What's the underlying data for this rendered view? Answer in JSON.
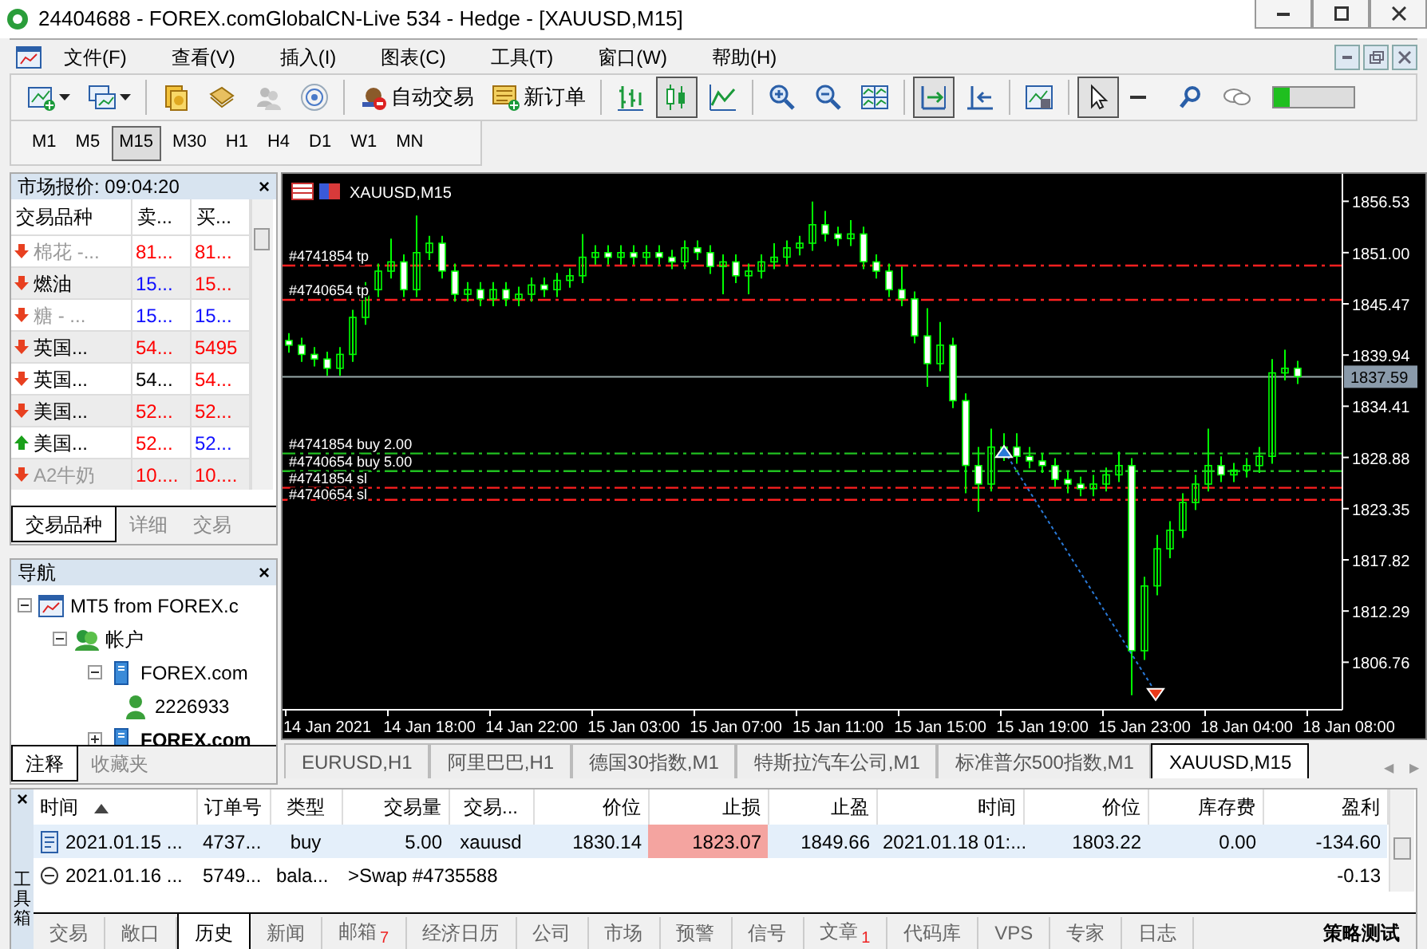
{
  "window": {
    "title": "24404688 - FOREX.comGlobalCN-Live 534 - Hedge - [XAUUSD,M15]"
  },
  "menu": [
    "文件(F)",
    "查看(V)",
    "插入(I)",
    "图表(C)",
    "工具(T)",
    "窗口(W)",
    "帮助(H)"
  ],
  "toolbar": [
    {
      "pressed": false,
      "dropdown": true
    },
    {
      "pressed": false,
      "dropdown": true
    },
    {
      "pressed": false
    },
    {
      "pressed": false
    },
    {
      "pressed": false
    },
    {
      "pressed": false
    },
    {
      "pressed": false,
      "label": "自动交易"
    },
    {
      "pressed": false,
      "label": "新订单"
    },
    {
      "pressed": false
    },
    {
      "pressed": true
    },
    {
      "pressed": false
    },
    {
      "pressed": false
    },
    {
      "pressed": false
    },
    {
      "pressed": false
    },
    {
      "pressed": true
    },
    {
      "pressed": false
    },
    {
      "pressed": false
    },
    {
      "pressed": true
    },
    {
      "pressed": false
    },
    {
      "pressed": false
    },
    {
      "pressed": false
    }
  ],
  "connection_meter": {
    "level": 0.2
  },
  "timeframes": [
    {
      "label": "M1",
      "selected": false
    },
    {
      "label": "M5",
      "selected": false
    },
    {
      "label": "M15",
      "selected": true
    },
    {
      "label": "M30",
      "selected": false
    },
    {
      "label": "H1",
      "selected": false
    },
    {
      "label": "H4",
      "selected": false
    },
    {
      "label": "D1",
      "selected": false
    },
    {
      "label": "W1",
      "selected": false
    },
    {
      "label": "MN",
      "selected": false
    }
  ],
  "market_watch": {
    "title": "市场报价: 09:04:20",
    "close": "×",
    "columns": [
      "交易品种",
      "卖...",
      "买..."
    ],
    "rows": [
      {
        "symbol": "棉花 -...",
        "rising": false,
        "greyed": true,
        "bid": {
          "text": "81...",
          "color": "#ff0000"
        },
        "ask": {
          "text": "81...",
          "color": "#ff0000"
        }
      },
      {
        "symbol": "燃油",
        "rising": false,
        "greyed": false,
        "bid": {
          "text": "15...",
          "color": "#1010ff"
        },
        "ask": {
          "text": "15...",
          "color": "#ff0000"
        }
      },
      {
        "symbol": "糖 - ...",
        "rising": false,
        "greyed": true,
        "bid": {
          "text": "15...",
          "color": "#1010ff"
        },
        "ask": {
          "text": "15...",
          "color": "#1010ff"
        }
      },
      {
        "symbol": "英国...",
        "rising": false,
        "greyed": false,
        "bid": {
          "text": "54...",
          "color": "#ff0000"
        },
        "ask": {
          "text": "5495",
          "color": "#ff0000"
        }
      },
      {
        "symbol": "英国...",
        "rising": false,
        "greyed": false,
        "bid": {
          "text": "54...",
          "color": "#000000"
        },
        "ask": {
          "text": "54...",
          "color": "#ff0000"
        }
      },
      {
        "symbol": "美国...",
        "rising": false,
        "greyed": false,
        "bid": {
          "text": "52...",
          "color": "#ff0000"
        },
        "ask": {
          "text": "52...",
          "color": "#ff0000"
        }
      },
      {
        "symbol": "美国...",
        "rising": true,
        "greyed": false,
        "bid": {
          "text": "52...",
          "color": "#ff0000"
        },
        "ask": {
          "text": "52...",
          "color": "#1010ff"
        }
      },
      {
        "symbol": "A2牛奶",
        "rising": false,
        "greyed": true,
        "bid": {
          "text": "10....",
          "color": "#ff0000"
        },
        "ask": {
          "text": "10....",
          "color": "#ff0000"
        }
      }
    ],
    "tabs": [
      {
        "label": "交易品种",
        "selected": true
      },
      {
        "label": "详细",
        "selected": false
      },
      {
        "label": "交易",
        "selected": false
      }
    ]
  },
  "navigator": {
    "title": "导航",
    "close": "×",
    "tree": [
      {
        "label": "MT5 from FOREX.c",
        "expanded": true,
        "children": [
          {
            "label": "帐户",
            "expanded": true,
            "children": [
              {
                "label": "FOREX.com",
                "expanded": true,
                "children": [
                  {
                    "label": "2226933"
                  }
                ]
              },
              {
                "label": "FOREX.com",
                "expanded": false,
                "bold": true
              }
            ]
          }
        ]
      }
    ],
    "tabs": [
      {
        "label": "注释",
        "selected": true
      },
      {
        "label": "收藏夹",
        "selected": false
      }
    ]
  },
  "chart": {
    "title": "XAUUSD,M15",
    "current_price": "1837.59",
    "chart_data": {
      "type": "candlestick",
      "ylim": [
        1801.63,
        1859.5
      ],
      "ref_lines": [
        {
          "axis": "y",
          "value": 1849.6,
          "label": "#4741854 tp",
          "color": "#ff2020"
        },
        {
          "axis": "y",
          "value": 1845.9,
          "label": "#4740654 tp",
          "color": "#ff2020"
        },
        {
          "axis": "y",
          "value": 1837.59,
          "color": "#99aaaa"
        },
        {
          "axis": "y",
          "value": 1829.3,
          "label": "#4741854 buy 2.00",
          "color": "#20c020"
        },
        {
          "axis": "y",
          "value": 1827.4,
          "label": "#4740654 buy 5.00",
          "color": "#20c020"
        },
        {
          "axis": "y",
          "value": 1825.6,
          "label": "#4741854 sl",
          "color": "#ff2020"
        },
        {
          "axis": "y",
          "value": 1824.3,
          "label": "#4740654 sl",
          "color": "#ff2020"
        }
      ],
      "yticks": [
        {
          "value": 1856.53,
          "label": "1856.53"
        },
        {
          "value": 1851,
          "label": "1851.00"
        },
        {
          "value": 1845.47,
          "label": "1845.47"
        },
        {
          "value": 1839.94,
          "label": "1839.94"
        },
        {
          "value": 1834.41,
          "label": "1834.41"
        },
        {
          "value": 1828.88,
          "label": "1828.88"
        },
        {
          "value": 1823.35,
          "label": "1823.35"
        },
        {
          "value": 1817.82,
          "label": "1817.82"
        },
        {
          "value": 1812.29,
          "label": "1812.29"
        },
        {
          "value": 1806.76,
          "label": "1806.76"
        }
      ],
      "categories": [
        null,
        null,
        null,
        "14 Jan 2021",
        null,
        null,
        null,
        null,
        null,
        null,
        null,
        "14 Jan 18:00",
        null,
        null,
        null,
        null,
        null,
        null,
        null,
        "14 Jan 22:00",
        null,
        null,
        null,
        null,
        null,
        null,
        null,
        "15 Jan 03:00",
        null,
        null,
        null,
        null,
        null,
        null,
        null,
        "15 Jan 07:00",
        null,
        null,
        null,
        null,
        null,
        null,
        null,
        "15 Jan 11:00",
        null,
        null,
        null,
        null,
        null,
        null,
        null,
        "15 Jan 15:00",
        null,
        null,
        null,
        null,
        null,
        null,
        null,
        "15 Jan 19:00",
        null,
        null,
        null,
        null,
        null,
        null,
        null,
        "15 Jan 23:00",
        null,
        null,
        null,
        null,
        null,
        null,
        null,
        "18 Jan 04:00",
        null,
        null,
        null,
        null,
        null,
        null,
        null,
        "18 Jan 08:00"
      ],
      "ohlc": [
        [
          1841.5,
          1842.3,
          1840.2,
          1841
        ],
        [
          1841,
          1841.8,
          1839.2,
          1840
        ],
        [
          1840,
          1840.8,
          1838.7,
          1839.5
        ],
        [
          1839.5,
          1840.3,
          1837.7,
          1838.5
        ],
        [
          1838.5,
          1840.8,
          1837.7,
          1840
        ],
        [
          1840,
          1844.8,
          1839.2,
          1844
        ],
        [
          1844,
          1847.8,
          1843.2,
          1847
        ],
        [
          1847,
          1849.8,
          1846.2,
          1849
        ],
        [
          1849,
          1852.5,
          1848.2,
          1850
        ],
        [
          1850,
          1850.8,
          1846.2,
          1847
        ],
        [
          1847,
          1855,
          1846.2,
          1851
        ],
        [
          1851,
          1852.8,
          1850.2,
          1852
        ],
        [
          1852,
          1852.8,
          1848.2,
          1849
        ],
        [
          1849,
          1849.8,
          1845.7,
          1846.5
        ],
        [
          1846.5,
          1847.8,
          1845.7,
          1847
        ],
        [
          1847,
          1847.8,
          1845.2,
          1846
        ],
        [
          1846,
          1847.8,
          1845.2,
          1847
        ],
        [
          1847,
          1847.8,
          1845.2,
          1846
        ],
        [
          1846,
          1847.3,
          1845.2,
          1846.5
        ],
        [
          1846.5,
          1848.3,
          1845.7,
          1847.5
        ],
        [
          1847.5,
          1848.3,
          1846.2,
          1847
        ],
        [
          1847,
          1848.8,
          1846.2,
          1848
        ],
        [
          1848,
          1849.3,
          1847.2,
          1848.5
        ],
        [
          1848.5,
          1853,
          1847.7,
          1850.5
        ],
        [
          1850.5,
          1851.8,
          1849.7,
          1851
        ],
        [
          1851,
          1851.8,
          1849.7,
          1850.5
        ],
        [
          1850.5,
          1851.8,
          1849.7,
          1851
        ],
        [
          1851,
          1851.8,
          1849.7,
          1850.5
        ],
        [
          1850.5,
          1851.8,
          1849.7,
          1851
        ],
        [
          1851,
          1851.8,
          1849.7,
          1850.5
        ],
        [
          1850.5,
          1851.3,
          1849.2,
          1850
        ],
        [
          1850,
          1852.3,
          1849.2,
          1851.5
        ],
        [
          1851.5,
          1852.3,
          1850.2,
          1851
        ],
        [
          1851,
          1851.8,
          1848.7,
          1849.5
        ],
        [
          1849.5,
          1850.8,
          1846.5,
          1850
        ],
        [
          1850,
          1850.8,
          1847.7,
          1848.5
        ],
        [
          1848.5,
          1849.8,
          1846.5,
          1849
        ],
        [
          1849,
          1850.8,
          1848.2,
          1850
        ],
        [
          1850,
          1852,
          1849.2,
          1850.5
        ],
        [
          1850.5,
          1852.3,
          1849.7,
          1851.5
        ],
        [
          1851.5,
          1852.8,
          1850.7,
          1852
        ],
        [
          1852,
          1856.5,
          1851.2,
          1854
        ],
        [
          1854,
          1855.5,
          1852.2,
          1853
        ],
        [
          1853,
          1853.8,
          1851.7,
          1852.5
        ],
        [
          1852.5,
          1854.5,
          1851.7,
          1853
        ],
        [
          1853,
          1853.8,
          1849.2,
          1850
        ],
        [
          1850,
          1850.8,
          1848.2,
          1849
        ],
        [
          1849,
          1849.8,
          1846.2,
          1847
        ],
        [
          1847,
          1849.5,
          1845.2,
          1846
        ],
        [
          1846,
          1846.8,
          1841.2,
          1842
        ],
        [
          1842,
          1845,
          1836.5,
          1839
        ],
        [
          1839,
          1843.5,
          1838.2,
          1841
        ],
        [
          1841,
          1841.8,
          1834.2,
          1835
        ],
        [
          1835,
          1835.8,
          1825,
          1828
        ],
        [
          1828,
          1830,
          1823,
          1826
        ],
        [
          1826,
          1832,
          1825.2,
          1830
        ],
        [
          1830,
          1831.5,
          1828.5,
          1830
        ],
        [
          1830,
          1831.5,
          1828.2,
          1829
        ],
        [
          1829,
          1830,
          1827.7,
          1828.5
        ],
        [
          1828.5,
          1829.3,
          1827.2,
          1828
        ],
        [
          1828,
          1828.8,
          1825.7,
          1826.5
        ],
        [
          1826.5,
          1827.3,
          1825,
          1826
        ],
        [
          1826,
          1826.8,
          1824.7,
          1825.5
        ],
        [
          1825.5,
          1827,
          1824.7,
          1826
        ],
        [
          1826,
          1827.8,
          1825.2,
          1827
        ],
        [
          1827,
          1829.5,
          1826.2,
          1828
        ],
        [
          1828,
          1828.8,
          1803.2,
          1808
        ],
        [
          1808,
          1816,
          1807,
          1815
        ],
        [
          1815,
          1820.5,
          1814,
          1819
        ],
        [
          1819,
          1822,
          1818,
          1821
        ],
        [
          1821,
          1825,
          1820.2,
          1824
        ],
        [
          1824,
          1827,
          1823.2,
          1826
        ],
        [
          1826,
          1832,
          1825.2,
          1828
        ],
        [
          1828,
          1829,
          1826.2,
          1827
        ],
        [
          1827,
          1828.3,
          1826.2,
          1827.5
        ],
        [
          1827.5,
          1828.8,
          1826.7,
          1828
        ],
        [
          1828,
          1830,
          1827.2,
          1829
        ],
        [
          1829,
          1839.5,
          1828.2,
          1838
        ],
        [
          1838,
          1840.5,
          1837.2,
          1838.5
        ],
        [
          1838.5,
          1839.3,
          1836.8,
          1837.6
        ],
        null,
        null,
        null,
        null
      ]
    }
  },
  "chart_tabs": [
    {
      "label": "EURUSD,H1",
      "selected": false
    },
    {
      "label": "阿里巴巴,H1",
      "selected": false
    },
    {
      "label": "德国30指数,M1",
      "selected": false
    },
    {
      "label": "特斯拉汽车公司,M1",
      "selected": false
    },
    {
      "label": "标准普尔500指数,M1",
      "selected": false
    },
    {
      "label": "XAUUSD,M15",
      "selected": true
    }
  ],
  "chart_tab_arrows": [
    "◀",
    "▶"
  ],
  "toolbox": {
    "title": "工具箱",
    "close": "×",
    "columns": [
      {
        "label": "时间",
        "sort_ascending": true
      },
      {
        "label": "订单号"
      },
      {
        "label": "类型"
      },
      {
        "label": "交易量"
      },
      {
        "label": "交易..."
      },
      {
        "label": "价位"
      },
      {
        "label": "止损"
      },
      {
        "label": "止盈"
      },
      {
        "label": "时间"
      },
      {
        "label": "价位"
      },
      {
        "label": "库存费"
      },
      {
        "label": "盈利"
      }
    ],
    "rows": [
      {
        "kind": "trade",
        "selected": true,
        "stop_hit": true,
        "cells": [
          {
            "text": "2021.01.15 ..."
          },
          {
            "text": "4737..."
          },
          {
            "text": "buy"
          },
          {
            "text": "5.00"
          },
          {
            "text": "xauusd"
          },
          {
            "text": "1830.14"
          },
          {
            "text": "1823.07"
          },
          {
            "text": "1849.66"
          },
          {
            "text": "2021.01.18 01:..."
          },
          {
            "text": "1803.22"
          },
          {
            "text": "0.00"
          },
          {
            "text": "-134.60"
          }
        ]
      },
      {
        "kind": "balance",
        "selected": false,
        "cells": [
          {
            "text": "2021.01.16 ..."
          },
          {
            "text": "5749..."
          },
          {
            "text": "bala..."
          },
          {
            "text": ">Swap #4735588",
            "colspan": 8
          },
          {
            "text": "-0.13"
          }
        ]
      }
    ],
    "tabs": [
      {
        "label": "交易",
        "selected": false
      },
      {
        "label": "敞口",
        "selected": false
      },
      {
        "label": "历史",
        "selected": true
      },
      {
        "label": "新闻",
        "selected": false
      },
      {
        "label": "邮箱",
        "selected": false,
        "count": "7"
      },
      {
        "label": "经济日历",
        "selected": false
      },
      {
        "label": "公司",
        "selected": false
      },
      {
        "label": "市场",
        "selected": false
      },
      {
        "label": "预警",
        "selected": false
      },
      {
        "label": "信号",
        "selected": false
      },
      {
        "label": "文章",
        "selected": false,
        "count": "1"
      },
      {
        "label": "代码库",
        "selected": false
      },
      {
        "label": "VPS",
        "selected": false
      },
      {
        "label": "专家",
        "selected": false
      },
      {
        "label": "日志",
        "selected": false
      }
    ],
    "tester_tab": "策略测试"
  }
}
